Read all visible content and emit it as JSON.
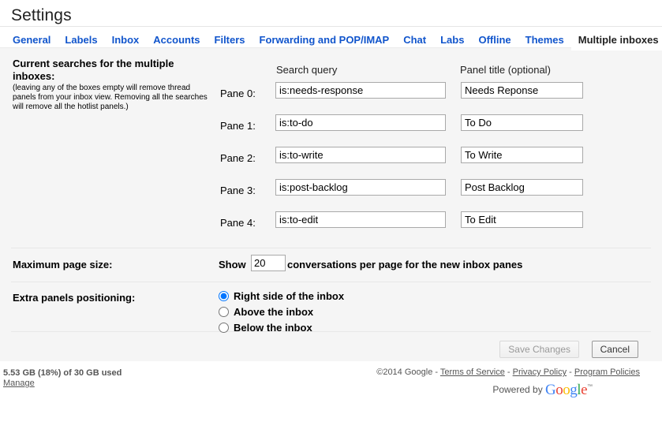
{
  "header": {
    "title": "Settings"
  },
  "tabs": [
    {
      "label": "General",
      "active": false
    },
    {
      "label": "Labels",
      "active": false
    },
    {
      "label": "Inbox",
      "active": false
    },
    {
      "label": "Accounts",
      "active": false
    },
    {
      "label": "Filters",
      "active": false
    },
    {
      "label": "Forwarding and POP/IMAP",
      "active": false
    },
    {
      "label": "Chat",
      "active": false
    },
    {
      "label": "Labs",
      "active": false
    },
    {
      "label": "Offline",
      "active": false
    },
    {
      "label": "Themes",
      "active": false
    },
    {
      "label": "Multiple inboxes",
      "active": true
    }
  ],
  "searches_section": {
    "heading": "Current searches for the multiple inboxes:",
    "note": "(leaving any of the boxes empty will remove thread panels from your inbox view. Removing all the searches will remove all the hotlist panels.)",
    "column_headers": {
      "query": "Search query",
      "panel_title": "Panel title (optional)"
    },
    "panes": [
      {
        "label": "Pane 0:",
        "query": "is:needs-response",
        "title": "Needs Reponse"
      },
      {
        "label": "Pane 1:",
        "query": "is:to-do",
        "title": "To Do"
      },
      {
        "label": "Pane 2:",
        "query": "is:to-write",
        "title": "To Write"
      },
      {
        "label": "Pane 3:",
        "query": "is:post-backlog",
        "title": "Post Backlog"
      },
      {
        "label": "Pane 4:",
        "query": "is:to-edit",
        "title": "To Edit"
      }
    ]
  },
  "page_size_section": {
    "label": "Maximum page size:",
    "show_word": "Show",
    "value": "20",
    "tail": "conversations per page for the new inbox panes"
  },
  "positioning_section": {
    "label": "Extra panels positioning:",
    "options": [
      {
        "label": "Right side of the inbox",
        "selected": true
      },
      {
        "label": "Above the inbox",
        "selected": false
      },
      {
        "label": "Below the inbox",
        "selected": false
      }
    ]
  },
  "actions": {
    "save_label": "Save Changes",
    "save_disabled": true,
    "cancel_label": "Cancel"
  },
  "footer": {
    "quota_text": "5.53 GB (18%) of 30 GB used",
    "manage_label": "Manage",
    "copyright": "©2014 Google",
    "sep": " - ",
    "links": [
      "Terms of Service",
      "Privacy Policy",
      "Program Policies"
    ],
    "powered_by": "Powered by",
    "logo_letters": [
      "G",
      "o",
      "o",
      "g",
      "l",
      "e"
    ],
    "trademark": "™"
  },
  "colors": {
    "link_blue": "#1155cc",
    "panel_gray": "#f5f5f5",
    "divider": "#e8e8e8",
    "input_border": "#a9a9a9",
    "google_blue": "#4285f4",
    "google_red": "#ea4335",
    "google_yellow": "#fbbc05",
    "google_green": "#34a853"
  }
}
